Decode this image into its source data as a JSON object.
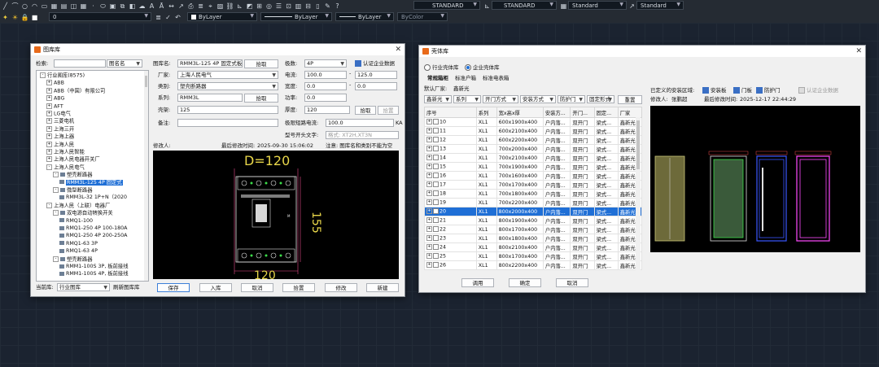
{
  "toolbar": {
    "layer_value": "0",
    "color_value": "ByLayer",
    "linetype_value": "ByLayer",
    "lineweight_value": "ByLayer",
    "plotstyle_value": "ByColor",
    "text_style": "STANDARD",
    "dim_style": "STANDARD",
    "table_style": "Standard",
    "mleader_style": "Standard"
  },
  "lib_win": {
    "title": "图库库",
    "search_label": "检索:",
    "search_mode": "图名名",
    "tree": [
      {
        "label": "行业图库(8575)",
        "level": 0,
        "pm": "-"
      },
      {
        "label": "ABB",
        "level": 1,
        "pm": "+"
      },
      {
        "label": "ABB（中国）有限公司",
        "level": 1,
        "pm": "+"
      },
      {
        "label": "ABG",
        "level": 1,
        "pm": "+"
      },
      {
        "label": "AFT",
        "level": 1,
        "pm": "+"
      },
      {
        "label": "LG电气",
        "level": 1,
        "pm": "+"
      },
      {
        "label": "三菱电机",
        "level": 1,
        "pm": "+"
      },
      {
        "label": "上海三开",
        "level": 1,
        "pm": "+"
      },
      {
        "label": "上海上器",
        "level": 1,
        "pm": "+"
      },
      {
        "label": "上海人民",
        "level": 1,
        "pm": "+"
      },
      {
        "label": "上海人民智能",
        "level": 1,
        "pm": "+"
      },
      {
        "label": "上海人民电器开关厂",
        "level": 1,
        "pm": "+"
      },
      {
        "label": "上海人民电气",
        "level": 1,
        "pm": "-"
      },
      {
        "label": "塑壳断路器",
        "level": 2,
        "pm": "-"
      },
      {
        "label": "RMM3L-125 4P 固定式",
        "level": 3,
        "pm": "",
        "selected": true
      },
      {
        "label": "微型断路器",
        "level": 2,
        "pm": "-"
      },
      {
        "label": "RMM3L-32 1P+N（2020",
        "level": 3,
        "pm": ""
      },
      {
        "label": "上海人民（上联）电器厂",
        "level": 1,
        "pm": "-"
      },
      {
        "label": "双电源自动转换开关",
        "level": 2,
        "pm": "-"
      },
      {
        "label": "RMQ1-100",
        "level": 3,
        "pm": ""
      },
      {
        "label": "RMQ1-250 4P 100-180A",
        "level": 3,
        "pm": ""
      },
      {
        "label": "RMQ1-250 4P 200-250A",
        "level": 3,
        "pm": ""
      },
      {
        "label": "RMQ1-63 3P",
        "level": 3,
        "pm": ""
      },
      {
        "label": "RMQ1-63 4P",
        "level": 3,
        "pm": ""
      },
      {
        "label": "塑壳断路器",
        "level": 2,
        "pm": "-"
      },
      {
        "label": "RMM1-100S 3P, 板前接线",
        "level": 3,
        "pm": ""
      },
      {
        "label": "RMM1-100S 4P, 板前接线",
        "level": 3,
        "pm": ""
      }
    ],
    "current_lib_label": "当前库:",
    "current_lib_value": "行业图库",
    "refresh_label": "刷新图库库",
    "fields": {
      "name_label": "图库名:",
      "name_value": "RMM3L-125 4P 固定式板前",
      "pick1": "拾取",
      "maker_label": "厂家:",
      "maker_value": "上海人民电气",
      "type_label": "类别:",
      "type_value": "塑壳断路器",
      "series_label": "系列:",
      "series_value": "RMM3L",
      "pick2": "拾取",
      "shell_label": "壳架:",
      "shell_value": "125",
      "note_label": "备注:",
      "note_value": "",
      "poles_label": "极数:",
      "poles_value": "4P",
      "cert_label": "认证企业数据",
      "current_label": "电流:",
      "current_value": "100.0",
      "current_max": "125.0",
      "width_label": "宽度:",
      "width_value": "0.0",
      "width_max": "0.0",
      "power_label": "功率:",
      "power_value": "0.0",
      "thick_label": "厚度:",
      "thick_value": "120",
      "pick3": "拾取",
      "pick3b": "拾置",
      "breaking_label": "极限短路电流:",
      "breaking_value": "100.0",
      "breaking_unit": "KA",
      "model_label": "型号开头文字:",
      "model_value": "格式: XT2H,XT3N",
      "modifier_label": "修改人:",
      "modified_label": "最后修改时间:",
      "modified_value": "2025-09-30 15:06:02",
      "note_warn": "注意: 图库名和类别不能为空"
    },
    "preview": {
      "dim_top": "D=120",
      "dim_side": "155",
      "dim_bottom": "120"
    },
    "buttons": [
      "保存",
      "入库",
      "取消",
      "拾置",
      "修改",
      "新建"
    ]
  },
  "cab_win": {
    "title": "壳体库",
    "radio_industry": "行业壳体库",
    "radio_enterprise": "企业壳体库",
    "tabs": [
      "常规箱柜",
      "标准户箱",
      "标准电表箱"
    ],
    "default_maker_label": "默认厂家:",
    "default_maker_value": "鑫新光",
    "filters": [
      "鑫新光",
      "系列",
      "开门方式",
      "安装方式",
      "防护门",
      "固定形式"
    ],
    "reset_label": "重置",
    "defined_label": "已定义的安装区域:",
    "chk_mount": "安装板",
    "chk_door": "门板",
    "chk_protect": "防护门",
    "chk_cert": "认证企业数据",
    "modifier_label": "修改人:",
    "modifier_value": "张鹏超",
    "modified_label": "最后修改时间:",
    "modified_value": "2025-12-17 22:44:29",
    "columns": [
      "序号",
      "系列",
      "宽x高x厚",
      "安装方...",
      "开门...",
      "固定...",
      "厂家"
    ],
    "rows": [
      [
        "10",
        "XL1",
        "600x1900x400",
        "户内落...",
        "双开门",
        "梁式...",
        "鑫新光"
      ],
      [
        "11",
        "XL1",
        "600x2100x400",
        "户内落...",
        "双开门",
        "梁式...",
        "鑫新光"
      ],
      [
        "12",
        "XL1",
        "600x2200x400",
        "户内落...",
        "双开门",
        "梁式...",
        "鑫新光"
      ],
      [
        "13",
        "XL1",
        "700x2000x400",
        "户内落...",
        "双开门",
        "梁式...",
        "鑫新光"
      ],
      [
        "14",
        "XL1",
        "700x2100x400",
        "户内落...",
        "双开门",
        "梁式...",
        "鑫新光"
      ],
      [
        "15",
        "XL1",
        "700x1900x400",
        "户内落...",
        "双开门",
        "梁式...",
        "鑫新光"
      ],
      [
        "16",
        "XL1",
        "700x1600x400",
        "户内落...",
        "双开门",
        "梁式...",
        "鑫新光"
      ],
      [
        "17",
        "XL1",
        "700x1700x400",
        "户内落...",
        "双开门",
        "梁式...",
        "鑫新光"
      ],
      [
        "18",
        "XL1",
        "700x1800x400",
        "户内落...",
        "双开门",
        "梁式...",
        "鑫新光"
      ],
      [
        "19",
        "XL1",
        "700x2200x400",
        "户内落...",
        "双开门",
        "梁式...",
        "鑫新光"
      ],
      [
        "20",
        "XL1",
        "800x2000x400",
        "户内落...",
        "双开门",
        "梁式...",
        "鑫新光"
      ],
      [
        "21",
        "XL1",
        "800x1900x400",
        "户内落...",
        "双开门",
        "梁式...",
        "鑫新光"
      ],
      [
        "22",
        "XL1",
        "800x1700x400",
        "户内落...",
        "双开门",
        "梁式...",
        "鑫新光"
      ],
      [
        "23",
        "XL1",
        "800x1800x400",
        "户内落...",
        "双开门",
        "梁式...",
        "鑫新光"
      ],
      [
        "24",
        "XL1",
        "800x2100x400",
        "户内落...",
        "双开门",
        "梁式...",
        "鑫新光"
      ],
      [
        "25",
        "XL1",
        "800x1700x400",
        "户内落...",
        "双开门",
        "梁式...",
        "鑫新光"
      ],
      [
        "26",
        "XL1",
        "800x2200x400",
        "户内落...",
        "双开门",
        "梁式...",
        "鑫新光"
      ]
    ],
    "selected_row": "20",
    "buttons": [
      "调用",
      "确定",
      "取消"
    ]
  }
}
